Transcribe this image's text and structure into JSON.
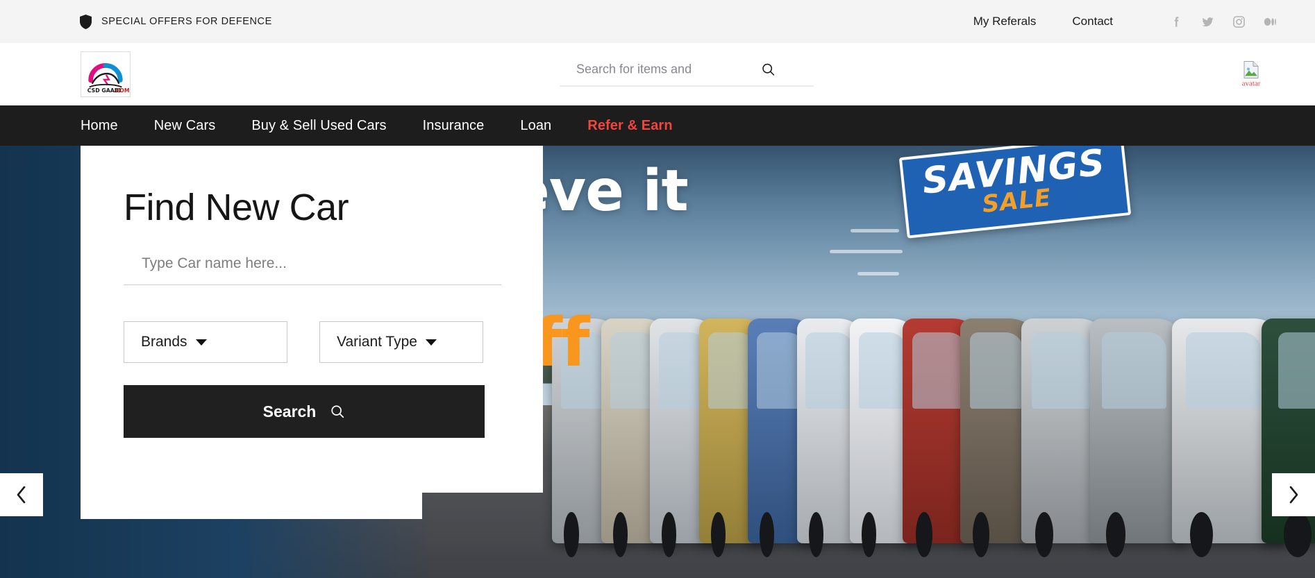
{
  "topbar": {
    "shield_icon": "shield-icon",
    "tagline": "SPECIAL OFFERS FOR DEFENCE",
    "links": [
      {
        "label": "My Referals"
      },
      {
        "label": "Contact"
      }
    ],
    "social": [
      {
        "name": "facebook-icon"
      },
      {
        "name": "twitter-icon"
      },
      {
        "name": "instagram-icon"
      },
      {
        "name": "medium-icon"
      }
    ],
    "bg_color": "#f4f4f4"
  },
  "header": {
    "logo": {
      "alt": "CSD GAADI .COM",
      "wordmark": "CSD GAADI",
      "domain": ".COM",
      "arc_left_color": "#e0117f",
      "arc_right_color": "#0d8fd4"
    },
    "search": {
      "placeholder": "Search for items and",
      "value": "",
      "icon": "search-icon"
    },
    "avatar": {
      "alt_text": "avatar",
      "icon": "broken-image-icon",
      "alt_color": "#d94a4a"
    }
  },
  "mainnav": {
    "bg_color": "#1d1d1d",
    "accent_color": "#f2453d",
    "items": [
      {
        "label": "Home",
        "accent": false
      },
      {
        "label": "New Cars",
        "accent": false
      },
      {
        "label": "Buy & Sell Used Cars",
        "accent": false
      },
      {
        "label": "Insurance",
        "accent": false
      },
      {
        "label": "Loan",
        "accent": false
      },
      {
        "label": "Refer & Earn",
        "accent": true
      }
    ]
  },
  "hero": {
    "headline": "Don't believe it",
    "off_text": "ff",
    "badge_main": "SAVINGS",
    "badge_sub": "SALE",
    "badge_bg": "#1f62b4",
    "badge_sub_color": "#f2a02b",
    "prev_arrow": "chevron-left-icon",
    "next_arrow": "chevron-right-icon"
  },
  "find_card": {
    "title": "Find New Car",
    "car_name": {
      "placeholder": "Type Car name here...",
      "value": ""
    },
    "brands_select": {
      "label": "Brands",
      "caret": "chevron-down-icon"
    },
    "variant_select": {
      "label": "Variant Type",
      "caret": "chevron-down-icon"
    },
    "search_button": {
      "label": "Search",
      "icon": "search-icon",
      "bg_color": "#202020"
    }
  }
}
